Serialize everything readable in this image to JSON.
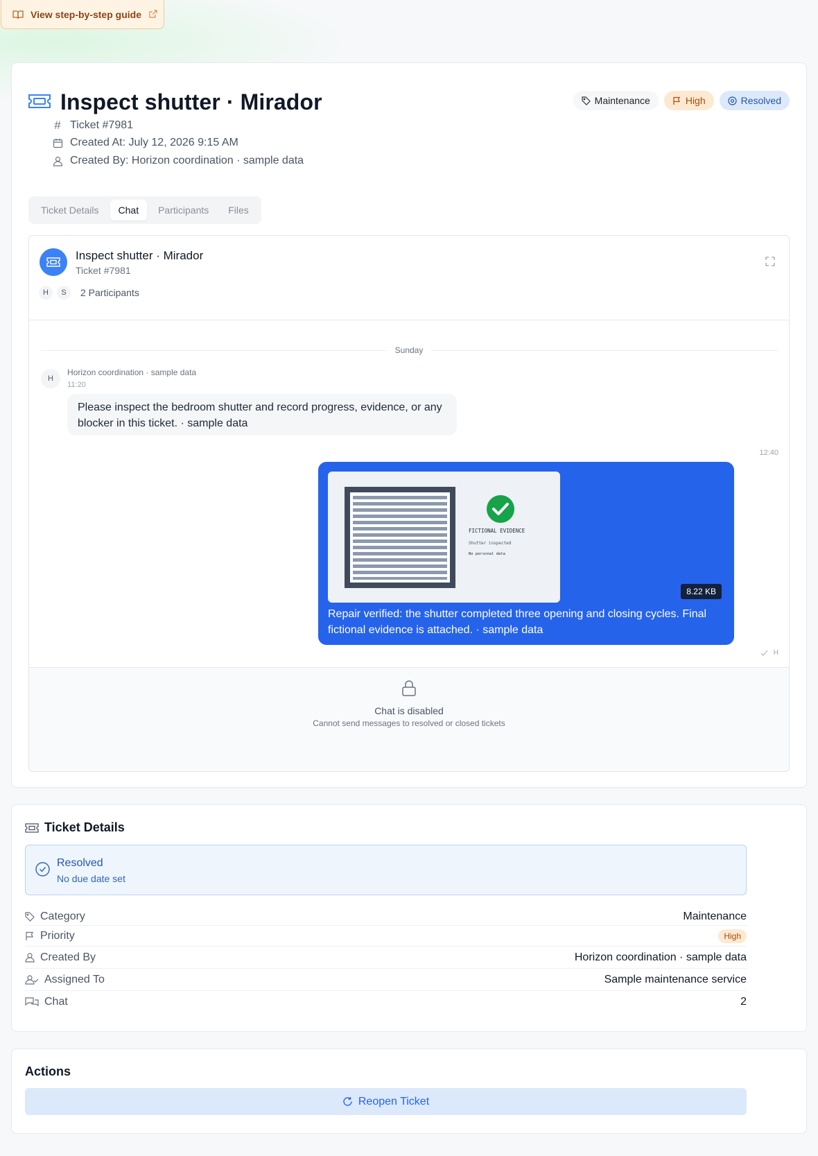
{
  "guide": {
    "label": "View step-by-step guide"
  },
  "ticket": {
    "title": "Inspect shutter · Mirador",
    "badges": {
      "category": "Maintenance",
      "priority": "High",
      "status": "Resolved"
    },
    "meta": {
      "number": "Ticket #7981",
      "created_at": "Created At: July 12, 2026 9:15 AM",
      "created_by": "Created By: Horizon coordination · sample data"
    }
  },
  "tabs": [
    {
      "label": "Ticket Details"
    },
    {
      "label": "Chat"
    },
    {
      "label": "Participants"
    },
    {
      "label": "Files"
    }
  ],
  "active_tab": "Chat",
  "chat": {
    "title": "Inspect shutter · Mirador",
    "subtitle": "Ticket #7981",
    "participants": [
      "H",
      "S"
    ],
    "participants_label": "2 Participants",
    "day_label": "Sunday",
    "messages": [
      {
        "avatar": "H",
        "author": "Horizon coordination · sample data",
        "time": "11:20",
        "text": "Please inspect the bedroom shutter and record progress, evidence, or any blocker in this ticket. · sample data"
      },
      {
        "time": "12:40",
        "attachment": {
          "caption_title": "FICTIONAL EVIDENCE",
          "caption_line1": "Shutter inspected",
          "caption_line2": "No personal data",
          "size": "8.22 KB"
        },
        "text": "Repair verified: the shutter completed three opening and closing cycles. Final fictional evidence is attached. · sample data",
        "read_by": "H"
      }
    ],
    "disabled": {
      "title": "Chat is disabled",
      "subtitle": "Cannot send messages to resolved or closed tickets"
    }
  },
  "details": {
    "title": "Ticket Details",
    "status": {
      "title": "Resolved",
      "subtitle": "No due date set"
    },
    "rows": [
      {
        "label": "Category",
        "value": "Maintenance"
      },
      {
        "label": "Priority",
        "value": "High"
      },
      {
        "label": "Created By",
        "value": "Horizon coordination · sample data"
      },
      {
        "label": "Assigned To",
        "value": "Sample maintenance service"
      },
      {
        "label": "Chat",
        "value": "2"
      }
    ]
  },
  "actions": {
    "title": "Actions",
    "reopen_label": "Reopen Ticket"
  },
  "colors": {
    "primary": "#2563eb",
    "priority": "#a24e0d",
    "resolved": "#2657a8",
    "guide": "#8a4417"
  }
}
